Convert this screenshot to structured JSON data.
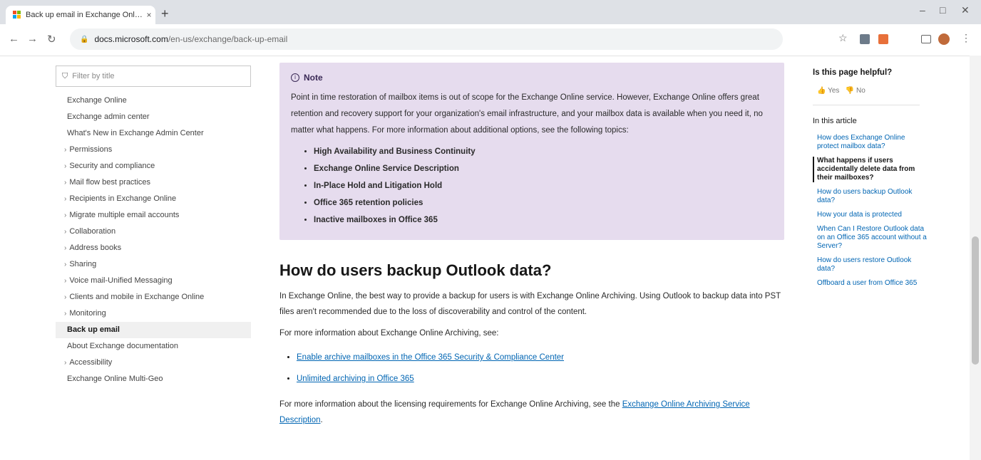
{
  "browser": {
    "tab_title": "Back up email in Exchange Onli…",
    "tab_close": "×",
    "new_tab": "+",
    "url_host": "docs.microsoft.com",
    "url_path": "/en-us/exchange/back-up-email",
    "window_controls": {
      "minimize": "–",
      "maximize": "□",
      "close": "✕"
    },
    "nav": {
      "back": "←",
      "forward": "→",
      "reload": "↻"
    }
  },
  "toc": {
    "filter_placeholder": "Filter by title",
    "items": [
      {
        "label": "Exchange Online",
        "chev": ""
      },
      {
        "label": "Exchange admin center",
        "chev": ""
      },
      {
        "label": "What's New in Exchange Admin Center",
        "chev": ""
      },
      {
        "label": "Permissions",
        "chev": "›"
      },
      {
        "label": "Security and compliance",
        "chev": "›"
      },
      {
        "label": "Mail flow best practices",
        "chev": "›"
      },
      {
        "label": "Recipients in Exchange Online",
        "chev": "›"
      },
      {
        "label": "Migrate multiple email accounts",
        "chev": "›"
      },
      {
        "label": "Collaboration",
        "chev": "›"
      },
      {
        "label": "Address books",
        "chev": "›"
      },
      {
        "label": "Sharing",
        "chev": "›"
      },
      {
        "label": "Voice mail-Unified Messaging",
        "chev": "›"
      },
      {
        "label": "Clients and mobile in Exchange Online",
        "chev": "›"
      },
      {
        "label": "Monitoring",
        "chev": "›"
      },
      {
        "label": "Back up email",
        "chev": ""
      },
      {
        "label": "About Exchange documentation",
        "chev": ""
      },
      {
        "label": "Accessibility",
        "chev": "›"
      },
      {
        "label": "Exchange Online Multi-Geo",
        "chev": ""
      }
    ]
  },
  "note": {
    "heading": "Note",
    "text": "Point in time restoration of mailbox items is out of scope for the Exchange Online service. However, Exchange Online offers great retention and recovery support for your organization's email infrastructure, and your mailbox data is available when you need it, no matter what happens. For more information about additional options, see the following topics:",
    "items": [
      "High Availability and Business Continuity",
      "Exchange Online Service Description",
      "In-Place Hold and Litigation Hold",
      "Office 365 retention policies",
      "Inactive mailboxes in Office 365"
    ]
  },
  "section": {
    "heading": "How do users backup Outlook data?",
    "para1": "In Exchange Online, the best way to provide a backup for users is with Exchange Online Archiving. Using Outlook to backup data into PST files aren't recommended due to the loss of discoverability and control of the content.",
    "para2": "For more information about Exchange Online Archiving, see:",
    "links": [
      "Enable archive mailboxes in the Office 365 Security & Compliance Center",
      "Unlimited archiving in Office 365"
    ],
    "para3_prefix": "For more information about the licensing requirements for Exchange Online Archiving, see the ",
    "para3_link": "Exchange Online Archiving Service Description",
    "para3_suffix": "."
  },
  "rail": {
    "helpful": "Is this page helpful?",
    "yes": "Yes",
    "no": "No",
    "in_this_article": "In this article",
    "links": [
      "How does Exchange Online protect mailbox data?",
      "What happens if users accidentally delete data from their mailboxes?",
      "How do users backup Outlook data?",
      "How your data is protected",
      "When Can I Restore Outlook data on an Office 365 account without a Server?",
      "How do users restore Outlook data?",
      "Offboard a user from Office 365"
    ],
    "current_index": 1
  },
  "colors": {
    "note_bg": "#e6dcee",
    "link": "#0065b3",
    "chrome_bg": "#dee1e6"
  }
}
